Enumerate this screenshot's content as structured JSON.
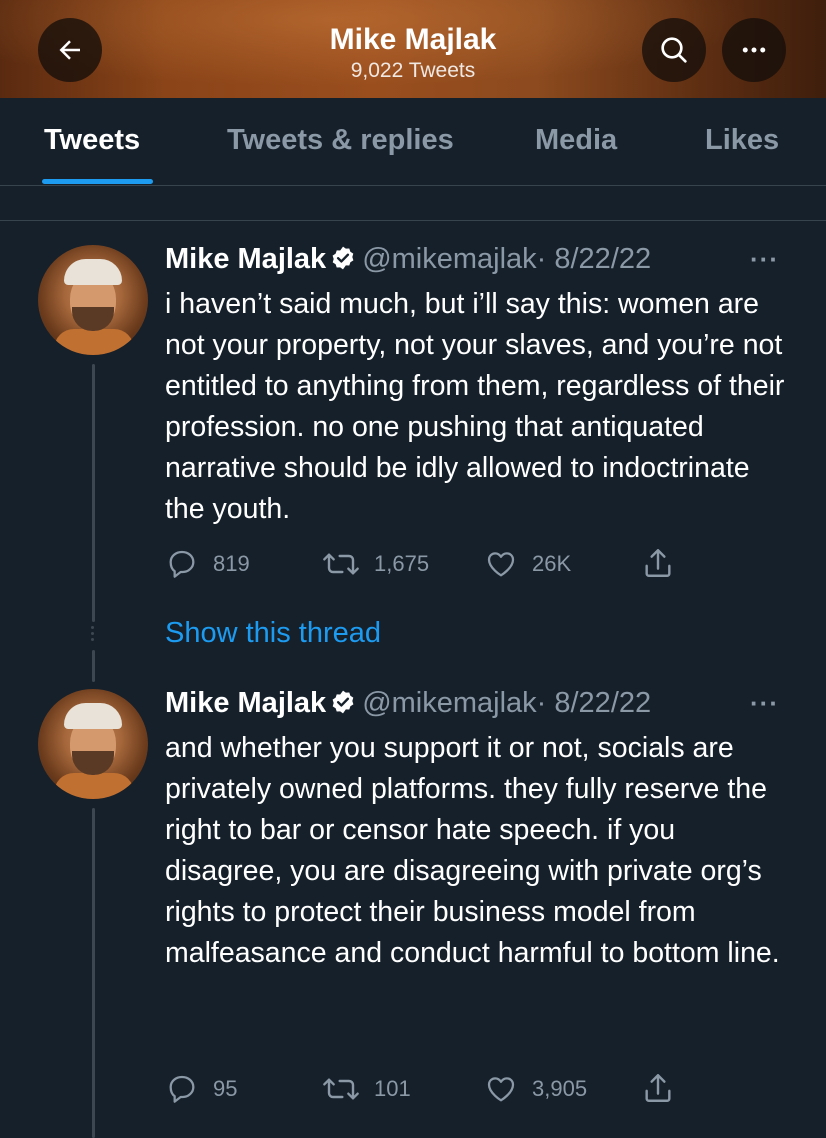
{
  "header": {
    "title": "Mike Majlak",
    "tweet_count": "9,022 Tweets"
  },
  "tabs": [
    {
      "label": "Tweets",
      "active": true
    },
    {
      "label": "Tweets & replies",
      "active": false
    },
    {
      "label": "Media",
      "active": false
    },
    {
      "label": "Likes",
      "active": false
    }
  ],
  "colors": {
    "background": "#15202b",
    "accent": "#1d9bf0",
    "muted": "#8b98a5",
    "divider": "#38444d"
  },
  "tweets": [
    {
      "display_name": "Mike Majlak",
      "handle": "@mikemajlak",
      "date": "· 8/22/22",
      "more": "···",
      "text": "i haven’t said much, but i’ll say this: women are not your property, not your slaves, and you’re not entitled to anything from them, regardless of their profession. no one pushing that antiquated narrative should be idly allowed to indoctrinate the youth.",
      "replies": "819",
      "retweets": "1,675",
      "likes": "26K"
    },
    {
      "display_name": "Mike Majlak",
      "handle": "@mikemajlak",
      "date": "· 8/22/22",
      "more": "···",
      "text": "and whether you support it or not, socials are privately owned platforms. they fully reserve the right to bar or censor hate speech. if you disagree, you are disagreeing with private org’s rights to protect their business model from malfeasance and conduct harmful to bottom line.",
      "replies": "95",
      "retweets": "101",
      "likes": "3,905"
    }
  ],
  "show_thread": "Show this thread",
  "icons": [
    "back-arrow-icon",
    "search-icon",
    "more-icon",
    "verified-badge-icon",
    "reply-icon",
    "retweet-icon",
    "like-icon",
    "share-icon"
  ]
}
